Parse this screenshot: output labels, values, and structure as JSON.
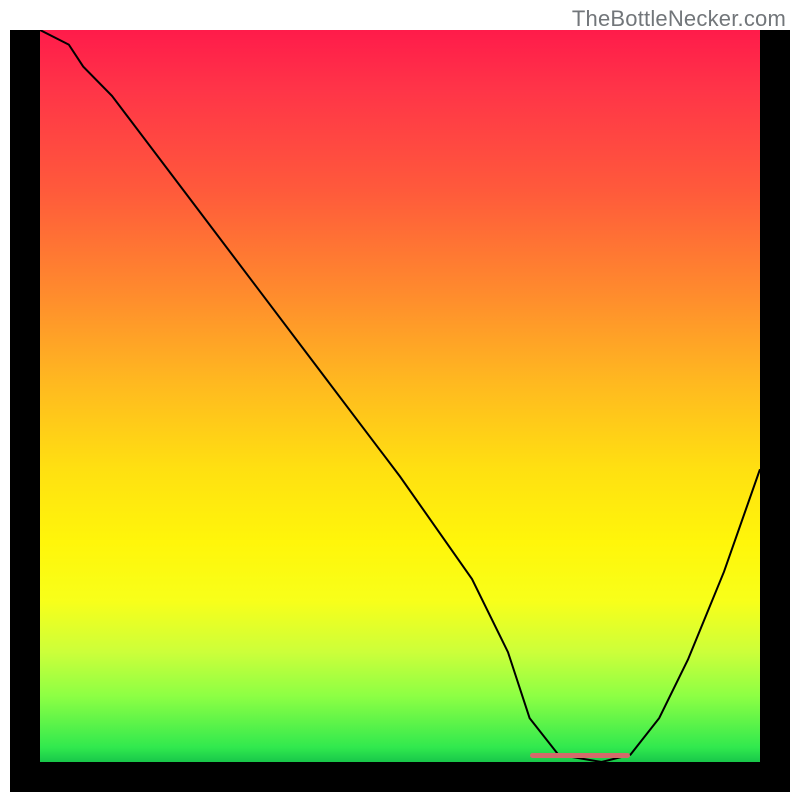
{
  "attribution": "TheBottleNecker.com",
  "chart_data": {
    "type": "line",
    "title": "",
    "xlabel": "",
    "ylabel": "",
    "xlim": [
      0,
      100
    ],
    "ylim": [
      0,
      100
    ],
    "x": [
      0,
      4,
      6,
      10,
      20,
      30,
      40,
      50,
      60,
      65,
      68,
      72,
      78,
      82,
      86,
      90,
      95,
      100
    ],
    "values": [
      100,
      98,
      95,
      91,
      78,
      65,
      52,
      39,
      25,
      15,
      6,
      1,
      0,
      1,
      6,
      14,
      26,
      40
    ],
    "optimal_band": {
      "start": 68,
      "end": 82
    },
    "gradient_stops": [
      {
        "pos": 0,
        "color": "#ff1b4a"
      },
      {
        "pos": 50,
        "color": "#ffd014"
      },
      {
        "pos": 78,
        "color": "#fbff18"
      },
      {
        "pos": 100,
        "color": "#18c74a"
      }
    ]
  }
}
